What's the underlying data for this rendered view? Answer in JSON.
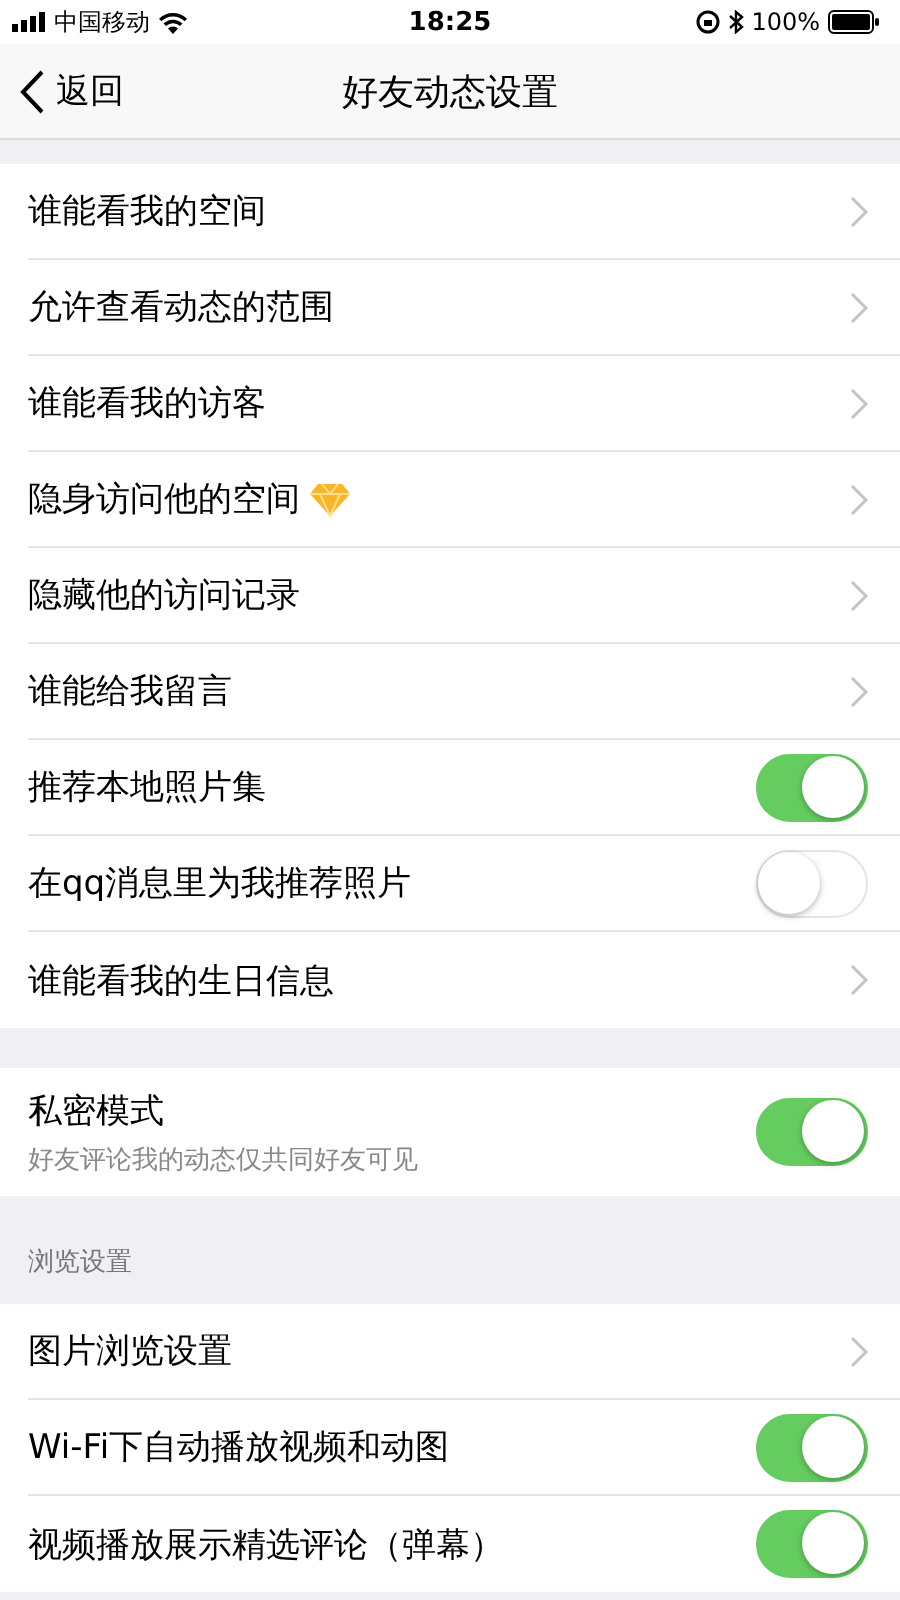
{
  "status_bar": {
    "carrier": "中国移动",
    "time": "18:25",
    "battery": "100%"
  },
  "nav": {
    "back": "返回",
    "title": "好友动态设置"
  },
  "sections": [
    {
      "rows": [
        {
          "kind": "link",
          "label": "谁能看我的空间"
        },
        {
          "kind": "link",
          "label": "允许查看动态的范围"
        },
        {
          "kind": "link",
          "label": "谁能看我的访客"
        },
        {
          "kind": "link",
          "label": "隐身访问他的空间",
          "vip": true
        },
        {
          "kind": "link",
          "label": "隐藏他的访问记录"
        },
        {
          "kind": "link",
          "label": "谁能给我留言"
        },
        {
          "kind": "toggle",
          "label": "推荐本地照片集",
          "on": true
        },
        {
          "kind": "toggle",
          "label": "在qq消息里为我推荐照片",
          "on": false
        },
        {
          "kind": "link",
          "label": "谁能看我的生日信息"
        }
      ]
    },
    {
      "rows": [
        {
          "kind": "toggle",
          "label": "私密模式",
          "subtitle": "好友评论我的动态仅共同好友可见",
          "on": true
        }
      ]
    },
    {
      "header": "浏览设置",
      "rows": [
        {
          "kind": "link",
          "label": "图片浏览设置"
        },
        {
          "kind": "toggle",
          "label": "Wi-Fi下自动播放视频和动图",
          "on": true
        },
        {
          "kind": "toggle",
          "label": "视频播放展示精选评论（弹幕）",
          "on": true
        }
      ]
    }
  ]
}
